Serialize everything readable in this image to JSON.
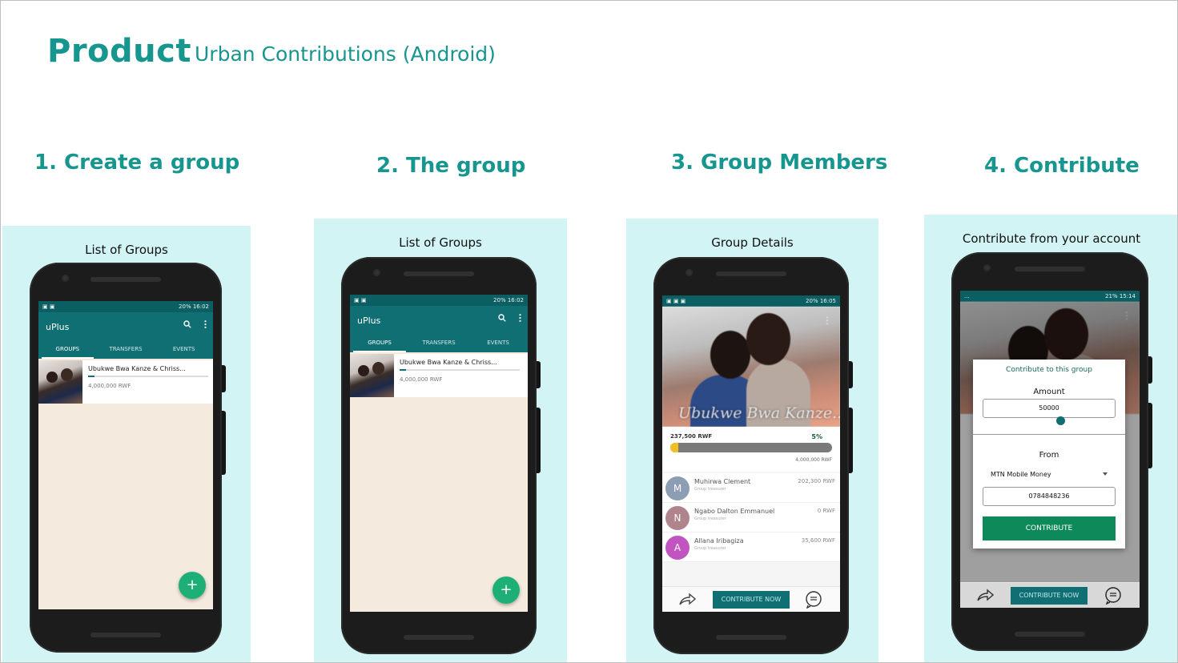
{
  "header": {
    "title": "Product",
    "subtitle": "Urban Contributions (Android)"
  },
  "colors": {
    "accent": "#17958f",
    "panel_bg": "#d2f4f4",
    "app_primary": "#0f6f73",
    "fab": "#1eaf77",
    "contribute_button": "#0e8a5a"
  },
  "steps": [
    {
      "title": "1. Create a group",
      "caption": "List of Groups"
    },
    {
      "title": "2. The group",
      "caption": "List of Groups"
    },
    {
      "title": "3. Group Members",
      "caption": "Group Details"
    },
    {
      "title": "4. Contribute",
      "caption": "Contribute from your account"
    }
  ],
  "screen1": {
    "status_right": "20% 16:02",
    "app_name": "uPlus",
    "tabs": [
      "GROUPS",
      "TRANSFERS",
      "EVENTS"
    ],
    "group": {
      "name": "Ubukwe Bwa Kanze & Chriss...",
      "amount": "4,000,000 RWF",
      "progress": 0.05
    },
    "fab_label": "+"
  },
  "screen2": {
    "status_right": "20% 16:02",
    "app_name": "uPlus",
    "tabs": [
      "GROUPS",
      "TRANSFERS",
      "EVENTS"
    ],
    "group": {
      "name": "Ubukwe Bwa Kanze & Chriss...",
      "amount": "4,000,000 RWF",
      "progress": 0.05
    },
    "fab_label": "+"
  },
  "screen3": {
    "status_right": "20% 16:05",
    "hero_name": "Ubukwe Bwa Kanze...",
    "raised": "237,500 RWF",
    "percent": "5%",
    "progress": 0.05,
    "goal": "4,000,000 RWF",
    "members": [
      {
        "initial": "M",
        "name": "Muhirwa Clement",
        "role": "Group treasurer",
        "amount": "202,300 RWF",
        "color": "#8d9db3"
      },
      {
        "initial": "N",
        "name": "Ngabo Dalton Emmanuel",
        "role": "Group treasurer",
        "amount": "0 RWF",
        "color": "#b0848c"
      },
      {
        "initial": "A",
        "name": "Allana Iribagiza",
        "role": "Group treasurer",
        "amount": "35,600 RWF",
        "color": "#c154c1"
      }
    ],
    "cta": "CONTRIBUTE NOW"
  },
  "screen4": {
    "status_left": "...",
    "status_right": "21% 15:14",
    "dialog_title": "Contribute to this group",
    "amount_label": "Amount",
    "amount_value": "50000",
    "from_label": "From",
    "method": "MTN Mobile Money",
    "phone": "0784848236",
    "button": "CONTRIBUTE",
    "cta": "CONTRIBUTE NOW"
  }
}
